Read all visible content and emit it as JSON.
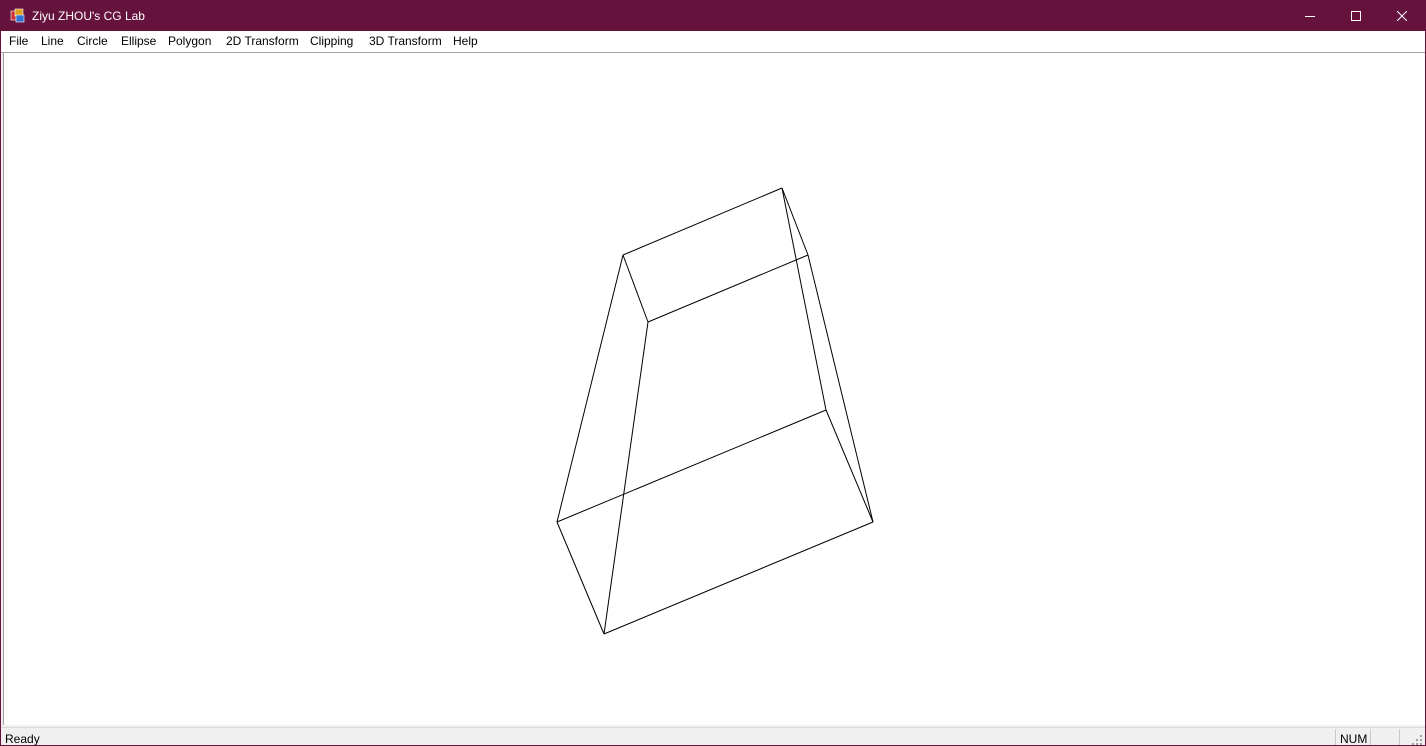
{
  "window": {
    "title": "Ziyu ZHOU's CG Lab",
    "title_bar_color": "#65123d",
    "icon": "app-icon",
    "controls": [
      "minimize-icon",
      "maximize-icon",
      "close-icon"
    ]
  },
  "menubar": {
    "items": [
      {
        "label": "File"
      },
      {
        "label": "Line"
      },
      {
        "label": "Circle"
      },
      {
        "label": "Ellipse"
      },
      {
        "label": "Polygon"
      },
      {
        "label": "2D Transform"
      },
      {
        "label": "Clipping"
      },
      {
        "label": "3D Transform"
      },
      {
        "label": "Help"
      }
    ]
  },
  "canvas": {
    "content": "wireframe-hexahedron",
    "stroke_color": "#000000"
  },
  "statusbar": {
    "text": "Ready",
    "num_indicator": "NUM"
  }
}
